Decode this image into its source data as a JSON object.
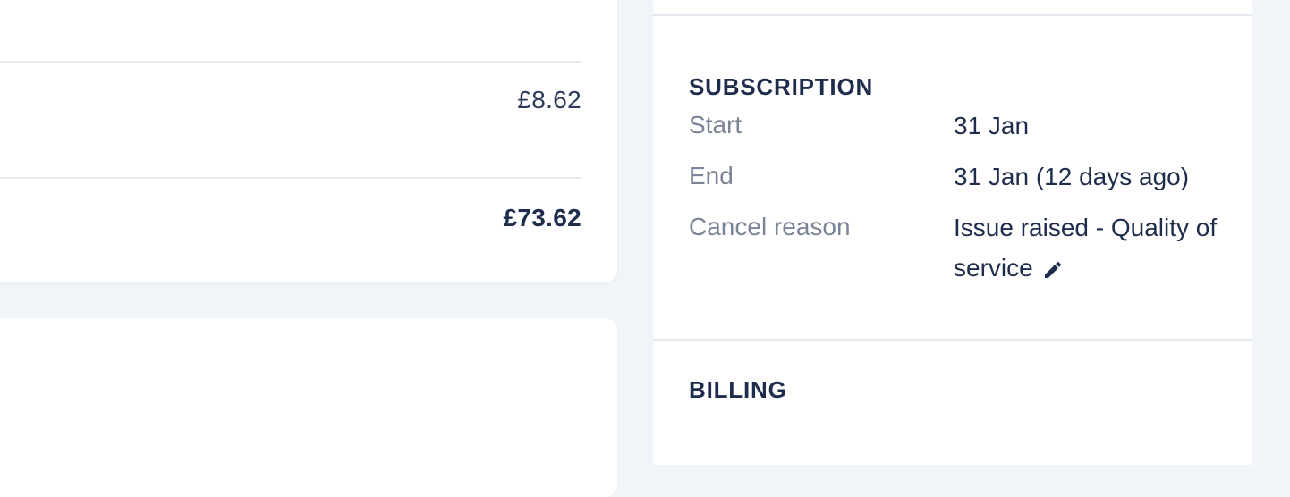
{
  "order_summary": {
    "fees_value": "£8.62",
    "total_value": "£73.62"
  },
  "subscription": {
    "heading": "SUBSCRIPTION",
    "rows": [
      {
        "label": "Start",
        "value": "31 Jan"
      },
      {
        "label": "End",
        "value": "31 Jan (12 days ago)"
      },
      {
        "label": "Cancel reason",
        "value": "Issue raised - Quality of service"
      }
    ],
    "edit_icon": "pencil-icon"
  },
  "billing": {
    "heading": "BILLING"
  }
}
